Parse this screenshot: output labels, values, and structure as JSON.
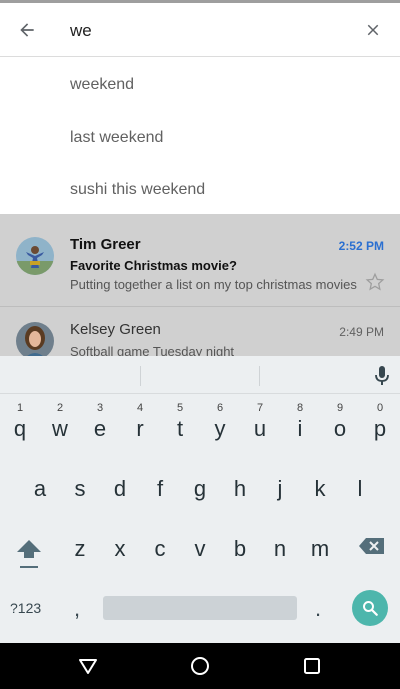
{
  "search": {
    "query": "we",
    "suggestions": [
      "weekend",
      "last weekend",
      "sushi this weekend"
    ]
  },
  "mails": [
    {
      "sender": "Tim Greer",
      "time": "2:52 PM",
      "subject": "Favorite Christmas movie?",
      "snippet": "Putting together a list on my top christmas movies",
      "unread": true,
      "time_color": "#2a6fd1"
    },
    {
      "sender": "Kelsey Green",
      "time": "2:49 PM",
      "subject": "",
      "snippet": "Softball game Tuesday night",
      "unread": false,
      "time_color": "#616161"
    }
  ],
  "keyboard": {
    "row1": [
      {
        "letter": "q",
        "hint": "1"
      },
      {
        "letter": "w",
        "hint": "2"
      },
      {
        "letter": "e",
        "hint": "3"
      },
      {
        "letter": "r",
        "hint": "4"
      },
      {
        "letter": "t",
        "hint": "5"
      },
      {
        "letter": "y",
        "hint": "6"
      },
      {
        "letter": "u",
        "hint": "7"
      },
      {
        "letter": "i",
        "hint": "8"
      },
      {
        "letter": "o",
        "hint": "9"
      },
      {
        "letter": "p",
        "hint": "0"
      }
    ],
    "row2": [
      "a",
      "s",
      "d",
      "f",
      "g",
      "h",
      "j",
      "k",
      "l"
    ],
    "row3": [
      "z",
      "x",
      "c",
      "v",
      "b",
      "n",
      "m"
    ],
    "symbols_label": "?123",
    "comma": ",",
    "period": "."
  },
  "icons": {
    "back": "arrow-back-icon",
    "clear": "close-icon",
    "star": "star-outline-icon",
    "mic": "mic-icon",
    "shift": "shift-icon",
    "backspace": "backspace-icon",
    "search": "search-icon",
    "nav_back": "triangle-back-icon",
    "nav_home": "circle-home-icon",
    "nav_recents": "square-recents-icon"
  },
  "colors": {
    "accent_teal": "#4db6ac",
    "time_blue": "#2a6fd1",
    "dim_overlay": "#d0d0d0"
  }
}
